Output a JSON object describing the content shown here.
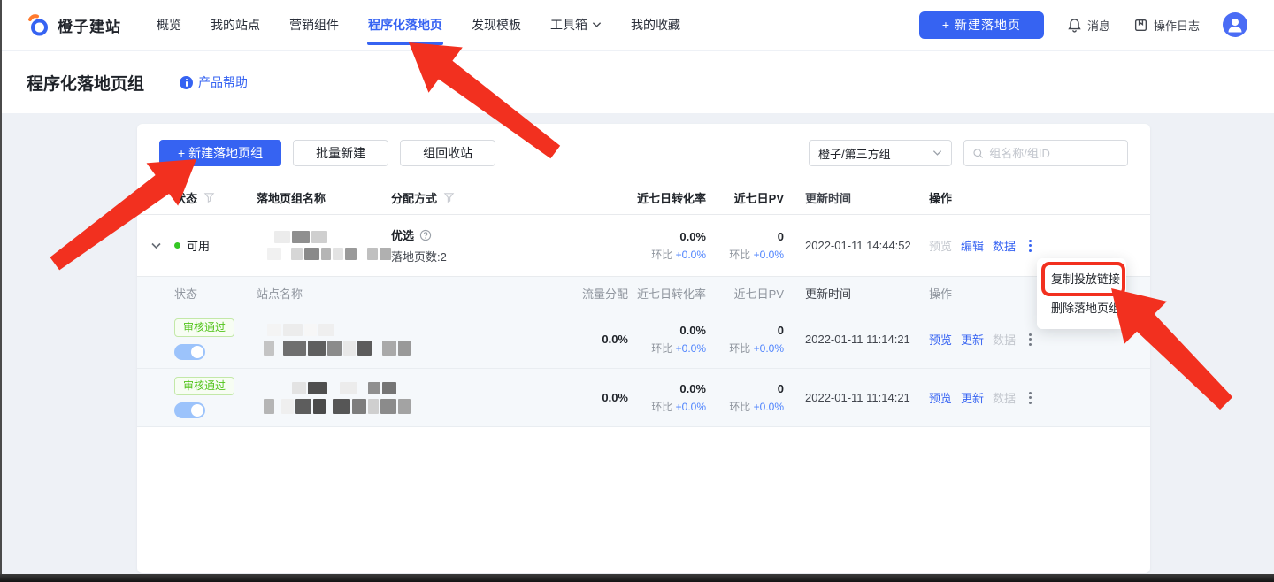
{
  "colors": {
    "primary": "#3663f2",
    "compare_blue": "#4e83fd",
    "success_green": "#52c41a",
    "annotation_red": "#f2301f",
    "page_background": "#eef1f6"
  },
  "brand": {
    "name": "橙子建站"
  },
  "nav": {
    "items": [
      "概览",
      "我的站点",
      "营销组件",
      "程序化落地页",
      "发现模板",
      "工具箱",
      "我的收藏"
    ],
    "active": "程序化落地页"
  },
  "header_actions": {
    "new_button": "+ 新建落地页",
    "messages": "消息",
    "logs": "操作日志"
  },
  "page": {
    "title": "程序化落地页组",
    "help": "产品帮助"
  },
  "toolbar": {
    "new_group": "+ 新建落地页组",
    "batch_create": "批量新建",
    "recycle_bin": "组回收站",
    "group_filter": "橙子/第三方组",
    "search_placeholder": "组名称/组ID"
  },
  "table": {
    "headers": {
      "status": "状态",
      "name": "落地页组名称",
      "method": "分配方式",
      "conv": "近七日转化率",
      "pv": "近七日PV",
      "time": "更新时间",
      "actions": "操作"
    },
    "group": {
      "status": "可用",
      "method": "优选",
      "method_note": "落地页数:2",
      "conv": "0.0%",
      "conv_cmp_label": "环比",
      "conv_cmp": "+0.0%",
      "pv": "0",
      "pv_cmp_label": "环比",
      "pv_cmp": "+0.0%",
      "time": "2022-01-11 14:44:52",
      "actions": {
        "preview": "预览",
        "edit": "编辑",
        "data": "数据"
      }
    },
    "sub": {
      "headers": {
        "status": "状态",
        "site": "站点名称",
        "traffic": "流量分配",
        "conv": "近七日转化率",
        "pv": "近七日PV",
        "time": "更新时间",
        "actions": "操作"
      },
      "rows": [
        {
          "badge": "审核通过",
          "toggle": "on",
          "traffic": "0.0%",
          "conv": "0.0%",
          "conv_cmp_label": "环比",
          "conv_cmp": "+0.0%",
          "pv": "0",
          "pv_cmp_label": "环比",
          "pv_cmp": "+0.0%",
          "time": "2022-01-11 11:14:21",
          "actions": {
            "preview": "预览",
            "update": "更新",
            "data": "数据"
          }
        },
        {
          "badge": "审核通过",
          "toggle": "on",
          "traffic": "0.0%",
          "conv": "0.0%",
          "conv_cmp_label": "环比",
          "conv_cmp": "+0.0%",
          "pv": "0",
          "pv_cmp_label": "环比",
          "pv_cmp": "+0.0%",
          "time": "2022-01-11 11:14:21",
          "actions": {
            "preview": "预览",
            "update": "更新",
            "data": "数据"
          }
        }
      ]
    }
  },
  "context_menu": {
    "items": [
      "复制投放链接",
      "删除落地页组"
    ]
  }
}
